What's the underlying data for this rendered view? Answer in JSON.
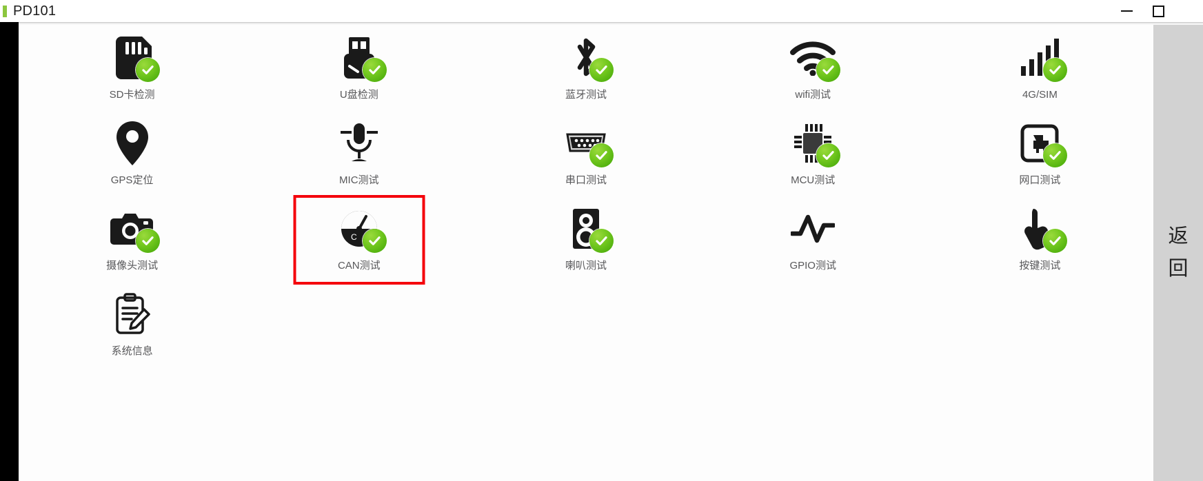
{
  "window": {
    "title": "PD101",
    "accent_color": "#8cc63e",
    "minimize_label": "Minimize",
    "maximize_label": "Maximize"
  },
  "side_panel": {
    "back_label": "返回",
    "back_char_1": "返",
    "back_char_2": "回",
    "background_color": "#d2d2d2"
  },
  "selection": {
    "color": "#f4020c",
    "selected_label": "CAN测试"
  },
  "grid": {
    "status_pass_color": "#73c81f",
    "items": [
      {
        "label": "SD卡检测",
        "icon": "sd-card-icon",
        "status": "pass"
      },
      {
        "label": "U盘检测",
        "icon": "usb-drive-icon",
        "status": "pass"
      },
      {
        "label": "蓝牙测试",
        "icon": "bluetooth-icon",
        "status": "pass"
      },
      {
        "label": "wifi测试",
        "icon": "wifi-icon",
        "status": "pass"
      },
      {
        "label": "4G/SIM",
        "icon": "signal-bars-icon",
        "status": "pass"
      },
      {
        "label": "GPS定位",
        "icon": "map-pin-icon",
        "status": "none"
      },
      {
        "label": "MIC测试",
        "icon": "microphone-icon",
        "status": "none"
      },
      {
        "label": "串口测试",
        "icon": "serial-port-icon",
        "status": "pass"
      },
      {
        "label": "MCU测试",
        "icon": "chip-icon",
        "status": "pass"
      },
      {
        "label": "网口测试",
        "icon": "ethernet-port-icon",
        "status": "pass"
      },
      {
        "label": "摄像头测试",
        "icon": "camera-icon",
        "status": "pass"
      },
      {
        "label": "CAN测试",
        "icon": "can-gauge-icon",
        "status": "pass"
      },
      {
        "label": "喇叭测试",
        "icon": "speaker-icon",
        "status": "pass"
      },
      {
        "label": "GPIO测试",
        "icon": "waveform-icon",
        "status": "none"
      },
      {
        "label": "按键测试",
        "icon": "touch-button-icon",
        "status": "pass"
      },
      {
        "label": "系统信息",
        "icon": "clipboard-edit-icon",
        "status": "none"
      }
    ]
  }
}
